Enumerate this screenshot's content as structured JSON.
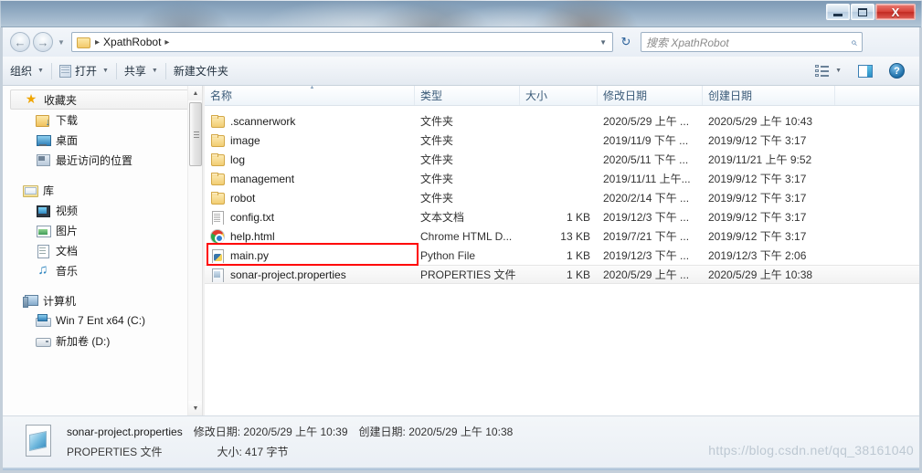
{
  "window": {
    "controls": {
      "minimize": "minimize",
      "maximize": "maximize",
      "close": "X"
    }
  },
  "address": {
    "back_glyph": "←",
    "forward_glyph": "→",
    "history_caret": "▼",
    "folder_name": "XpathRobot",
    "sep": "▸",
    "dropdown_caret": "▼",
    "refresh_glyph": "↻"
  },
  "search": {
    "placeholder": "搜索 XpathRobot",
    "icon_glyph": "⌕"
  },
  "toolbar": {
    "organize": "组织",
    "open": "打开",
    "share": "共享",
    "new_folder": "新建文件夹",
    "caret": "▼",
    "view_caret": "▼",
    "help_glyph": "?"
  },
  "sidebar": {
    "groups": [
      {
        "header": {
          "label": "收藏夹",
          "icon": "star-icon",
          "selected": true
        },
        "items": [
          {
            "label": "下载",
            "icon": "download-icon"
          },
          {
            "label": "桌面",
            "icon": "desktop-icon"
          },
          {
            "label": "最近访问的位置",
            "icon": "recent-places-icon"
          }
        ]
      },
      {
        "header": {
          "label": "库",
          "icon": "library-icon",
          "selected": false
        },
        "items": [
          {
            "label": "视频",
            "icon": "video-icon"
          },
          {
            "label": "图片",
            "icon": "picture-icon"
          },
          {
            "label": "文档",
            "icon": "document-icon"
          },
          {
            "label": "音乐",
            "icon": "music-icon"
          }
        ]
      },
      {
        "header": {
          "label": "计算机",
          "icon": "computer-icon",
          "selected": false
        },
        "items": [
          {
            "label": "Win 7 Ent x64 (C:)",
            "icon": "drive-system-icon"
          },
          {
            "label": "新加卷 (D:)",
            "icon": "drive-icon"
          }
        ]
      }
    ],
    "scroll": {
      "up_glyph": "▲",
      "down_glyph": "▼"
    }
  },
  "filelist": {
    "columns": [
      {
        "key": "name",
        "label": "名称",
        "sorted": true
      },
      {
        "key": "type",
        "label": "类型",
        "sorted": false
      },
      {
        "key": "size",
        "label": "大小",
        "sorted": false
      },
      {
        "key": "modified",
        "label": "修改日期",
        "sorted": false
      },
      {
        "key": "created",
        "label": "创建日期",
        "sorted": false
      }
    ],
    "rows": [
      {
        "name": ".scannerwork",
        "icon": "folder-icon",
        "type": "文件夹",
        "size": "",
        "modified": "2020/5/29 上午 ...",
        "created": "2020/5/29 上午 10:43",
        "selected": false
      },
      {
        "name": "image",
        "icon": "folder-icon",
        "type": "文件夹",
        "size": "",
        "modified": "2019/11/9 下午 ...",
        "created": "2019/9/12 下午 3:17",
        "selected": false
      },
      {
        "name": "log",
        "icon": "folder-icon",
        "type": "文件夹",
        "size": "",
        "modified": "2020/5/11 下午 ...",
        "created": "2019/11/21 上午 9:52",
        "selected": false
      },
      {
        "name": "management",
        "icon": "folder-icon",
        "type": "文件夹",
        "size": "",
        "modified": "2019/11/11 上午...",
        "created": "2019/9/12 下午 3:17",
        "selected": false
      },
      {
        "name": "robot",
        "icon": "folder-icon",
        "type": "文件夹",
        "size": "",
        "modified": "2020/2/14 下午 ...",
        "created": "2019/9/12 下午 3:17",
        "selected": false
      },
      {
        "name": "config.txt",
        "icon": "text-file-icon",
        "type": "文本文档",
        "size": "1 KB",
        "modified": "2019/12/3 下午 ...",
        "created": "2019/9/12 下午 3:17",
        "selected": false
      },
      {
        "name": "help.html",
        "icon": "chrome-html-icon",
        "type": "Chrome HTML D...",
        "size": "13 KB",
        "modified": "2019/7/21 下午 ...",
        "created": "2019/9/12 下午 3:17",
        "selected": false
      },
      {
        "name": "main.py",
        "icon": "python-file-icon",
        "type": "Python File",
        "size": "1 KB",
        "modified": "2019/12/3 下午 ...",
        "created": "2019/12/3 下午 2:06",
        "selected": false
      },
      {
        "name": "sonar-project.properties",
        "icon": "properties-file-icon",
        "type": "PROPERTIES 文件",
        "size": "1 KB",
        "modified": "2020/5/29 上午 ...",
        "created": "2020/5/29 上午 10:38",
        "selected": true
      }
    ],
    "annotation": {
      "color": "#ff0000",
      "target": "sonar-project.properties"
    }
  },
  "details": {
    "filename": "sonar-project.properties",
    "modified_label": "修改日期:",
    "modified_value": "2020/5/29 上午 10:39",
    "created_label": "创建日期:",
    "created_value": "2020/5/29 上午 10:38",
    "filetype": "PROPERTIES 文件",
    "size_label": "大小:",
    "size_value": "417 字节"
  },
  "watermark": {
    "text": "https://blog.csdn.net/qq_38161040"
  }
}
